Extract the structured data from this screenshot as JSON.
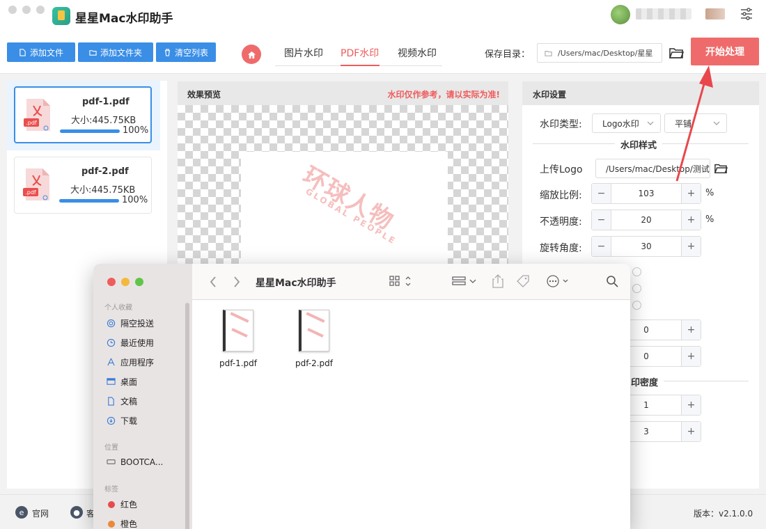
{
  "app": {
    "title": "星星Mac水印助手"
  },
  "toolbar": {
    "add_file": "添加文件",
    "add_folder": "添加文件夹",
    "clear_list": "清空列表",
    "tabs": [
      "图片水印",
      "PDF水印",
      "视频水印"
    ],
    "active_tab": "PDF水印",
    "save_dir_label": "保存目录：",
    "save_dir_value": "/Users/mac/Desktop/星星",
    "start_button": "开始处理"
  },
  "files": [
    {
      "name": "pdf-1.pdf",
      "size": "大小:445.75KB",
      "progress_text": "100%",
      "progress": 1.0,
      "icon_label": ".pdf"
    },
    {
      "name": "pdf-2.pdf",
      "size": "大小:445.75KB",
      "progress_text": "100%",
      "progress": 1.0,
      "icon_label": ".pdf"
    }
  ],
  "preview": {
    "title": "效果预览",
    "note": "水印仅作参考，请以实际为准!",
    "watermark_cn": "环球人物",
    "watermark_en": "GLOBAL PEOPLE"
  },
  "settings": {
    "title": "水印设置",
    "type_label": "水印类型:",
    "type_value": "Logo水印",
    "layout_value": "平铺",
    "style_section": "水印样式",
    "upload_label": "上传Logo",
    "upload_path": "/Users/mac/Desktop/测试",
    "scale_label": "缩放比例:",
    "scale_value": "103",
    "scale_unit": "%",
    "opacity_label": "不透明度:",
    "opacity_value": "20",
    "opacity_unit": "%",
    "rotation_label": "旋转角度:",
    "rotation_value": "30",
    "offset_values": [
      "0",
      "0"
    ],
    "density_section": "印密度",
    "density_values": [
      "1",
      "3"
    ],
    "minus": "−",
    "plus": "+"
  },
  "footer": {
    "website": "官网",
    "service": "客",
    "version_label": "版本：",
    "version_value": "v2.1.0.0"
  },
  "finder": {
    "title": "星星Mac水印助手",
    "favorites_label": "个人收藏",
    "favorites": [
      "隔空投送",
      "最近使用",
      "应用程序",
      "桌面",
      "文稿",
      "下载"
    ],
    "locations_label": "位置",
    "locations": [
      "BOOTCA..."
    ],
    "tags_label": "标签",
    "tags": [
      {
        "name": "红色",
        "color": "#e84b4b"
      },
      {
        "name": "橙色",
        "color": "#e9893a"
      }
    ],
    "files": [
      "pdf-1.pdf",
      "pdf-2.pdf"
    ]
  },
  "colors": {
    "primary_blue": "#3a8ee6",
    "accent_red": "#ef6b6b",
    "arrow_red": "#e8474c"
  }
}
